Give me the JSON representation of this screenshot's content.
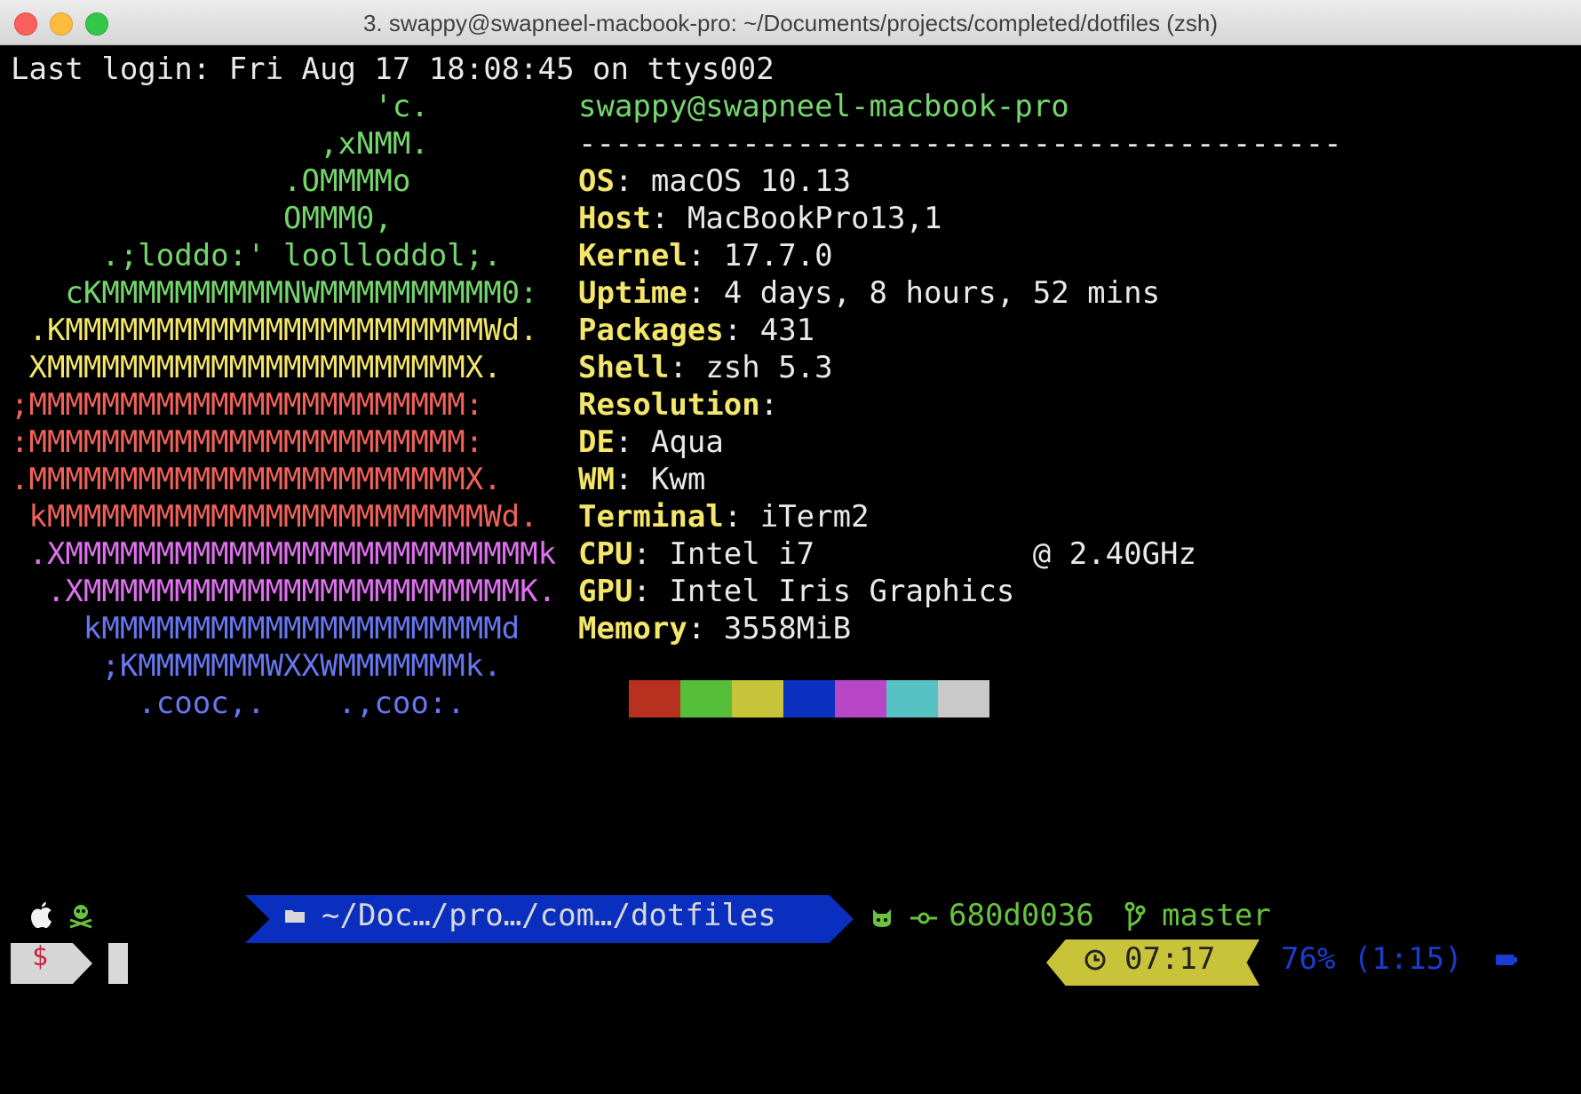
{
  "window": {
    "title": "3. swappy@swapneel-macbook-pro: ~/Documents/projects/completed/dotfiles (zsh)"
  },
  "terminal": {
    "last_login": "Last login: Fri Aug 17 18:08:45 on ttys002",
    "ascii_logo": [
      {
        "text": "                    'c.",
        "color": "green"
      },
      {
        "text": "                 ,xNMM.",
        "color": "green"
      },
      {
        "text": "               .OMMMMo",
        "color": "green"
      },
      {
        "text": "               OMMM0,",
        "color": "green"
      },
      {
        "text": "     .;loddo:' loolloddol;.",
        "color": "green"
      },
      {
        "text": "   cKMMMMMMMMMMNWMMMMMMMMMM0:",
        "color": "green"
      },
      {
        "text": " .KMMMMMMMMMMMMMMMMMMMMMMMWd.",
        "color": "yellow"
      },
      {
        "text": " XMMMMMMMMMMMMMMMMMMMMMMMX.",
        "color": "yellow"
      },
      {
        "text": ";MMMMMMMMMMMMMMMMMMMMMMMM:",
        "color": "red"
      },
      {
        "text": ":MMMMMMMMMMMMMMMMMMMMMMMM:",
        "color": "red"
      },
      {
        "text": ".MMMMMMMMMMMMMMMMMMMMMMMMX.",
        "color": "red"
      },
      {
        "text": " kMMMMMMMMMMMMMMMMMMMMMMMMWd.",
        "color": "red"
      },
      {
        "text": " .XMMMMMMMMMMMMMMMMMMMMMMMMMMk",
        "color": "pink"
      },
      {
        "text": "  .XMMMMMMMMMMMMMMMMMMMMMMMMK.",
        "color": "pink"
      },
      {
        "text": "    kMMMMMMMMMMMMMMMMMMMMMMd",
        "color": "blue"
      },
      {
        "text": "     ;KMMMMMMMWXXWMMMMMMMk.",
        "color": "blue"
      },
      {
        "text": "       .cooc,.    .,coo:.",
        "color": "blue"
      }
    ],
    "user_host": "swappy@swapneel-macbook-pro",
    "separator": "------------------------------------------",
    "info": [
      {
        "key": "OS",
        "value": "macOS 10.13"
      },
      {
        "key": "Host",
        "value": "MacBookPro13,1"
      },
      {
        "key": "Kernel",
        "value": "17.7.0"
      },
      {
        "key": "Uptime",
        "value": "4 days, 8 hours, 52 mins"
      },
      {
        "key": "Packages",
        "value": "431"
      },
      {
        "key": "Shell",
        "value": "zsh 5.3"
      },
      {
        "key": "Resolution",
        "value": ""
      },
      {
        "key": "DE",
        "value": "Aqua"
      },
      {
        "key": "WM",
        "value": "Kwm"
      },
      {
        "key": "Terminal",
        "value": "iTerm2"
      },
      {
        "key": "CPU",
        "value": "Intel i7            @ 2.40GHz"
      },
      {
        "key": "GPU",
        "value": "Intel Iris Graphics"
      },
      {
        "key": "Memory",
        "value": "3558MiB"
      }
    ],
    "palette": [
      "#b8301e",
      "#55bf39",
      "#c7c43a",
      "#0b2fbf",
      "#b847c8",
      "#56c2c3",
      "#c9c9c9"
    ]
  },
  "prompt": {
    "icons": [
      "apple-icon",
      "skull-icon",
      "folder-icon",
      "github-cat-icon",
      "commit-icon",
      "branch-icon",
      "clock-icon",
      "battery-icon"
    ],
    "path": "~/Doc…/pro…/com…/dotfiles",
    "commit": "680d0036",
    "branch": "master",
    "symbol": "$",
    "time": "07:17",
    "battery": "76% (1:15)"
  }
}
